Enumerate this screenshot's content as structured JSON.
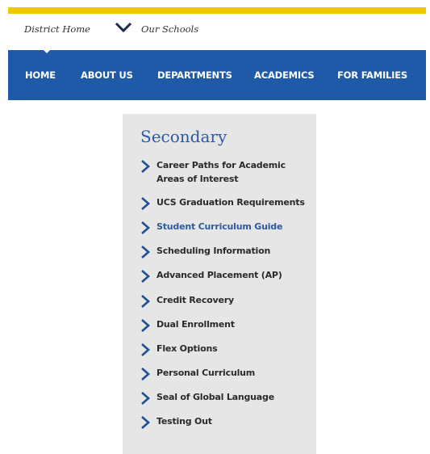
{
  "top_links": {
    "district_home": "District Home",
    "our_schools": "Our Schools"
  },
  "nav": {
    "items": [
      "HOME",
      "ABOUT US",
      "DEPARTMENTS",
      "ACADEMICS",
      "FOR FAMILIES"
    ]
  },
  "panel": {
    "title": "Secondary",
    "items": [
      {
        "label": "Career Paths for Academic Areas of Interest"
      },
      {
        "label": "UCS Graduation Requirements"
      },
      {
        "label": "Student Curriculum Guide"
      },
      {
        "label": "Scheduling Information"
      },
      {
        "label": "Advanced Placement (AP)"
      },
      {
        "label": "Credit Recovery"
      },
      {
        "label": "Dual Enrollment"
      },
      {
        "label": "Flex Options"
      },
      {
        "label": "Personal Curriculum"
      },
      {
        "label": "Seal of Global Language"
      },
      {
        "label": "Testing Out"
      }
    ]
  },
  "colors": {
    "gold": "#f0c800",
    "nav_blue": "#1f5aa8",
    "link_blue": "#2c5aa0",
    "panel_bg": "#e6e6e6"
  }
}
